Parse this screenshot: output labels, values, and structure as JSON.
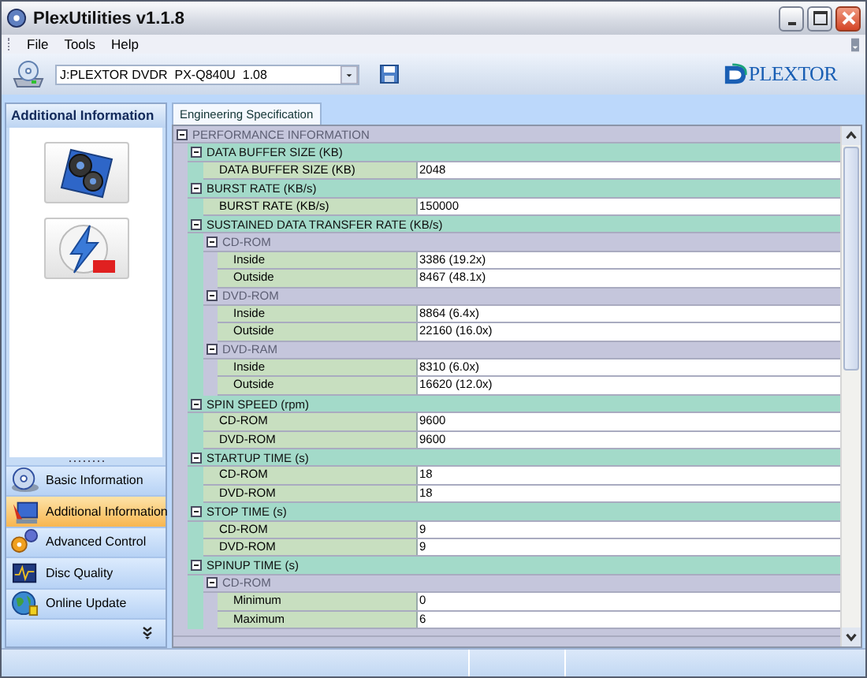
{
  "window": {
    "title": "PlexUtilities v1.1.8"
  },
  "menu": [
    "File",
    "Tools",
    "Help"
  ],
  "toolbar": {
    "drive": "J:PLEXTOR DVDR  PX-Q840U  1.08",
    "logo_text": "PLEXTOR"
  },
  "sidebar": {
    "header": "Additional Information",
    "items": [
      {
        "label": "Basic Information",
        "selected": false
      },
      {
        "label": "Additional Information",
        "selected": true
      },
      {
        "label": "Advanced Control",
        "selected": false
      },
      {
        "label": "Disc Quality",
        "selected": false
      },
      {
        "label": "Online Update",
        "selected": false
      }
    ]
  },
  "tabs": [
    {
      "label": "Engineering Specification",
      "selected": true
    }
  ],
  "tree": [
    {
      "kind": "category",
      "label": "PERFORMANCE INFORMATION",
      "expanded": true,
      "children": [
        {
          "kind": "section",
          "label": "DATA BUFFER SIZE (KB)",
          "expanded": true,
          "children": [
            {
              "kind": "item",
              "label": "DATA BUFFER SIZE (KB)",
              "value": "2048"
            }
          ]
        },
        {
          "kind": "section",
          "label": "BURST RATE (KB/s)",
          "expanded": true,
          "children": [
            {
              "kind": "item",
              "label": "BURST RATE (KB/s)",
              "value": "150000"
            }
          ]
        },
        {
          "kind": "section",
          "label": "SUSTAINED DATA TRANSFER RATE (KB/s)",
          "expanded": true,
          "children": [
            {
              "kind": "subgroup",
              "label": "CD-ROM",
              "expanded": true,
              "children": [
                {
                  "kind": "item",
                  "label": "Inside",
                  "value": "3386 (19.2x)"
                },
                {
                  "kind": "item",
                  "label": "Outside",
                  "value": "8467 (48.1x)"
                }
              ]
            },
            {
              "kind": "subgroup",
              "label": "DVD-ROM",
              "expanded": true,
              "children": [
                {
                  "kind": "item",
                  "label": "Inside",
                  "value": "8864 (6.4x)"
                },
                {
                  "kind": "item",
                  "label": "Outside",
                  "value": "22160 (16.0x)"
                }
              ]
            },
            {
              "kind": "subgroup",
              "label": "DVD-RAM",
              "expanded": true,
              "children": [
                {
                  "kind": "item",
                  "label": "Inside",
                  "value": "8310 (6.0x)"
                },
                {
                  "kind": "item",
                  "label": "Outside",
                  "value": "16620 (12.0x)"
                }
              ]
            }
          ]
        },
        {
          "kind": "section",
          "label": "SPIN SPEED (rpm)",
          "expanded": true,
          "children": [
            {
              "kind": "item",
              "label": "CD-ROM",
              "value": "9600"
            },
            {
              "kind": "item",
              "label": "DVD-ROM",
              "value": "9600"
            }
          ]
        },
        {
          "kind": "section",
          "label": "STARTUP TIME (s)",
          "expanded": true,
          "children": [
            {
              "kind": "item",
              "label": "CD-ROM",
              "value": "18"
            },
            {
              "kind": "item",
              "label": "DVD-ROM",
              "value": "18"
            }
          ]
        },
        {
          "kind": "section",
          "label": "STOP TIME (s)",
          "expanded": true,
          "children": [
            {
              "kind": "item",
              "label": "CD-ROM",
              "value": "9"
            },
            {
              "kind": "item",
              "label": "DVD-ROM",
              "value": "9"
            }
          ]
        },
        {
          "kind": "section",
          "label": "SPINUP TIME (s)",
          "expanded": true,
          "children": [
            {
              "kind": "subgroup",
              "label": "CD-ROM",
              "expanded": true,
              "children": [
                {
                  "kind": "item",
                  "label": "Minimum",
                  "value": "0"
                },
                {
                  "kind": "item",
                  "label": "Maximum",
                  "value": "6"
                }
              ]
            }
          ]
        }
      ]
    }
  ]
}
